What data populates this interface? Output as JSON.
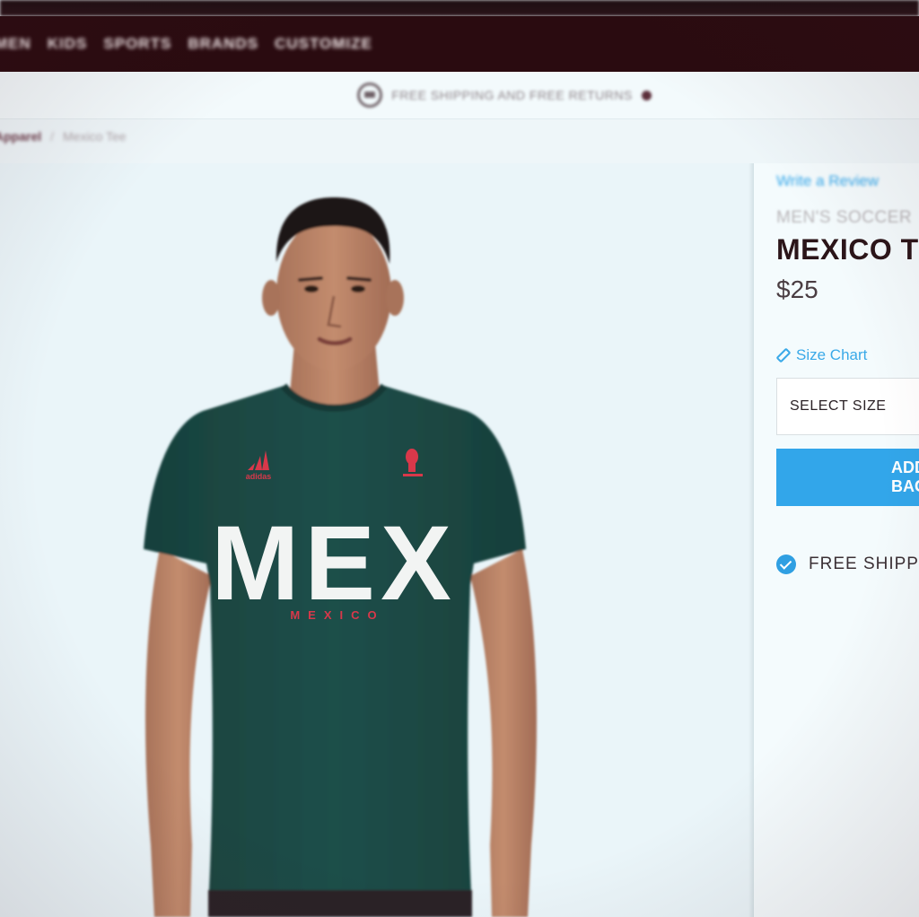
{
  "nav": {
    "items": [
      "MEN",
      "KIDS",
      "SPORTS",
      "BRANDS",
      "CUSTOMIZE"
    ]
  },
  "promo": {
    "text": "FREE SHIPPING AND FREE RETURNS"
  },
  "breadcrumb": {
    "parent": "Apparel",
    "separator": "/",
    "current": "Mexico Tee"
  },
  "product": {
    "image": {
      "shirt_graphic_text": "MEX",
      "shirt_subtext": "MEXICO",
      "brand_logo_text": "adidas"
    },
    "review_link": "Write a Review",
    "category": "MEN'S SOCCER",
    "title": "MEXICO TEE",
    "price": "$25",
    "size_chart_label": "Size Chart",
    "size_select_placeholder": "SELECT SIZE",
    "add_button_label": "ADD TO BAG",
    "free_shipping_label": "FREE SHIPPING"
  },
  "colors": {
    "nav_bg": "#2a0b10",
    "accent_blue": "#32a6ea",
    "shirt_green": "#1f4f4a",
    "logo_red": "#d8384a"
  }
}
